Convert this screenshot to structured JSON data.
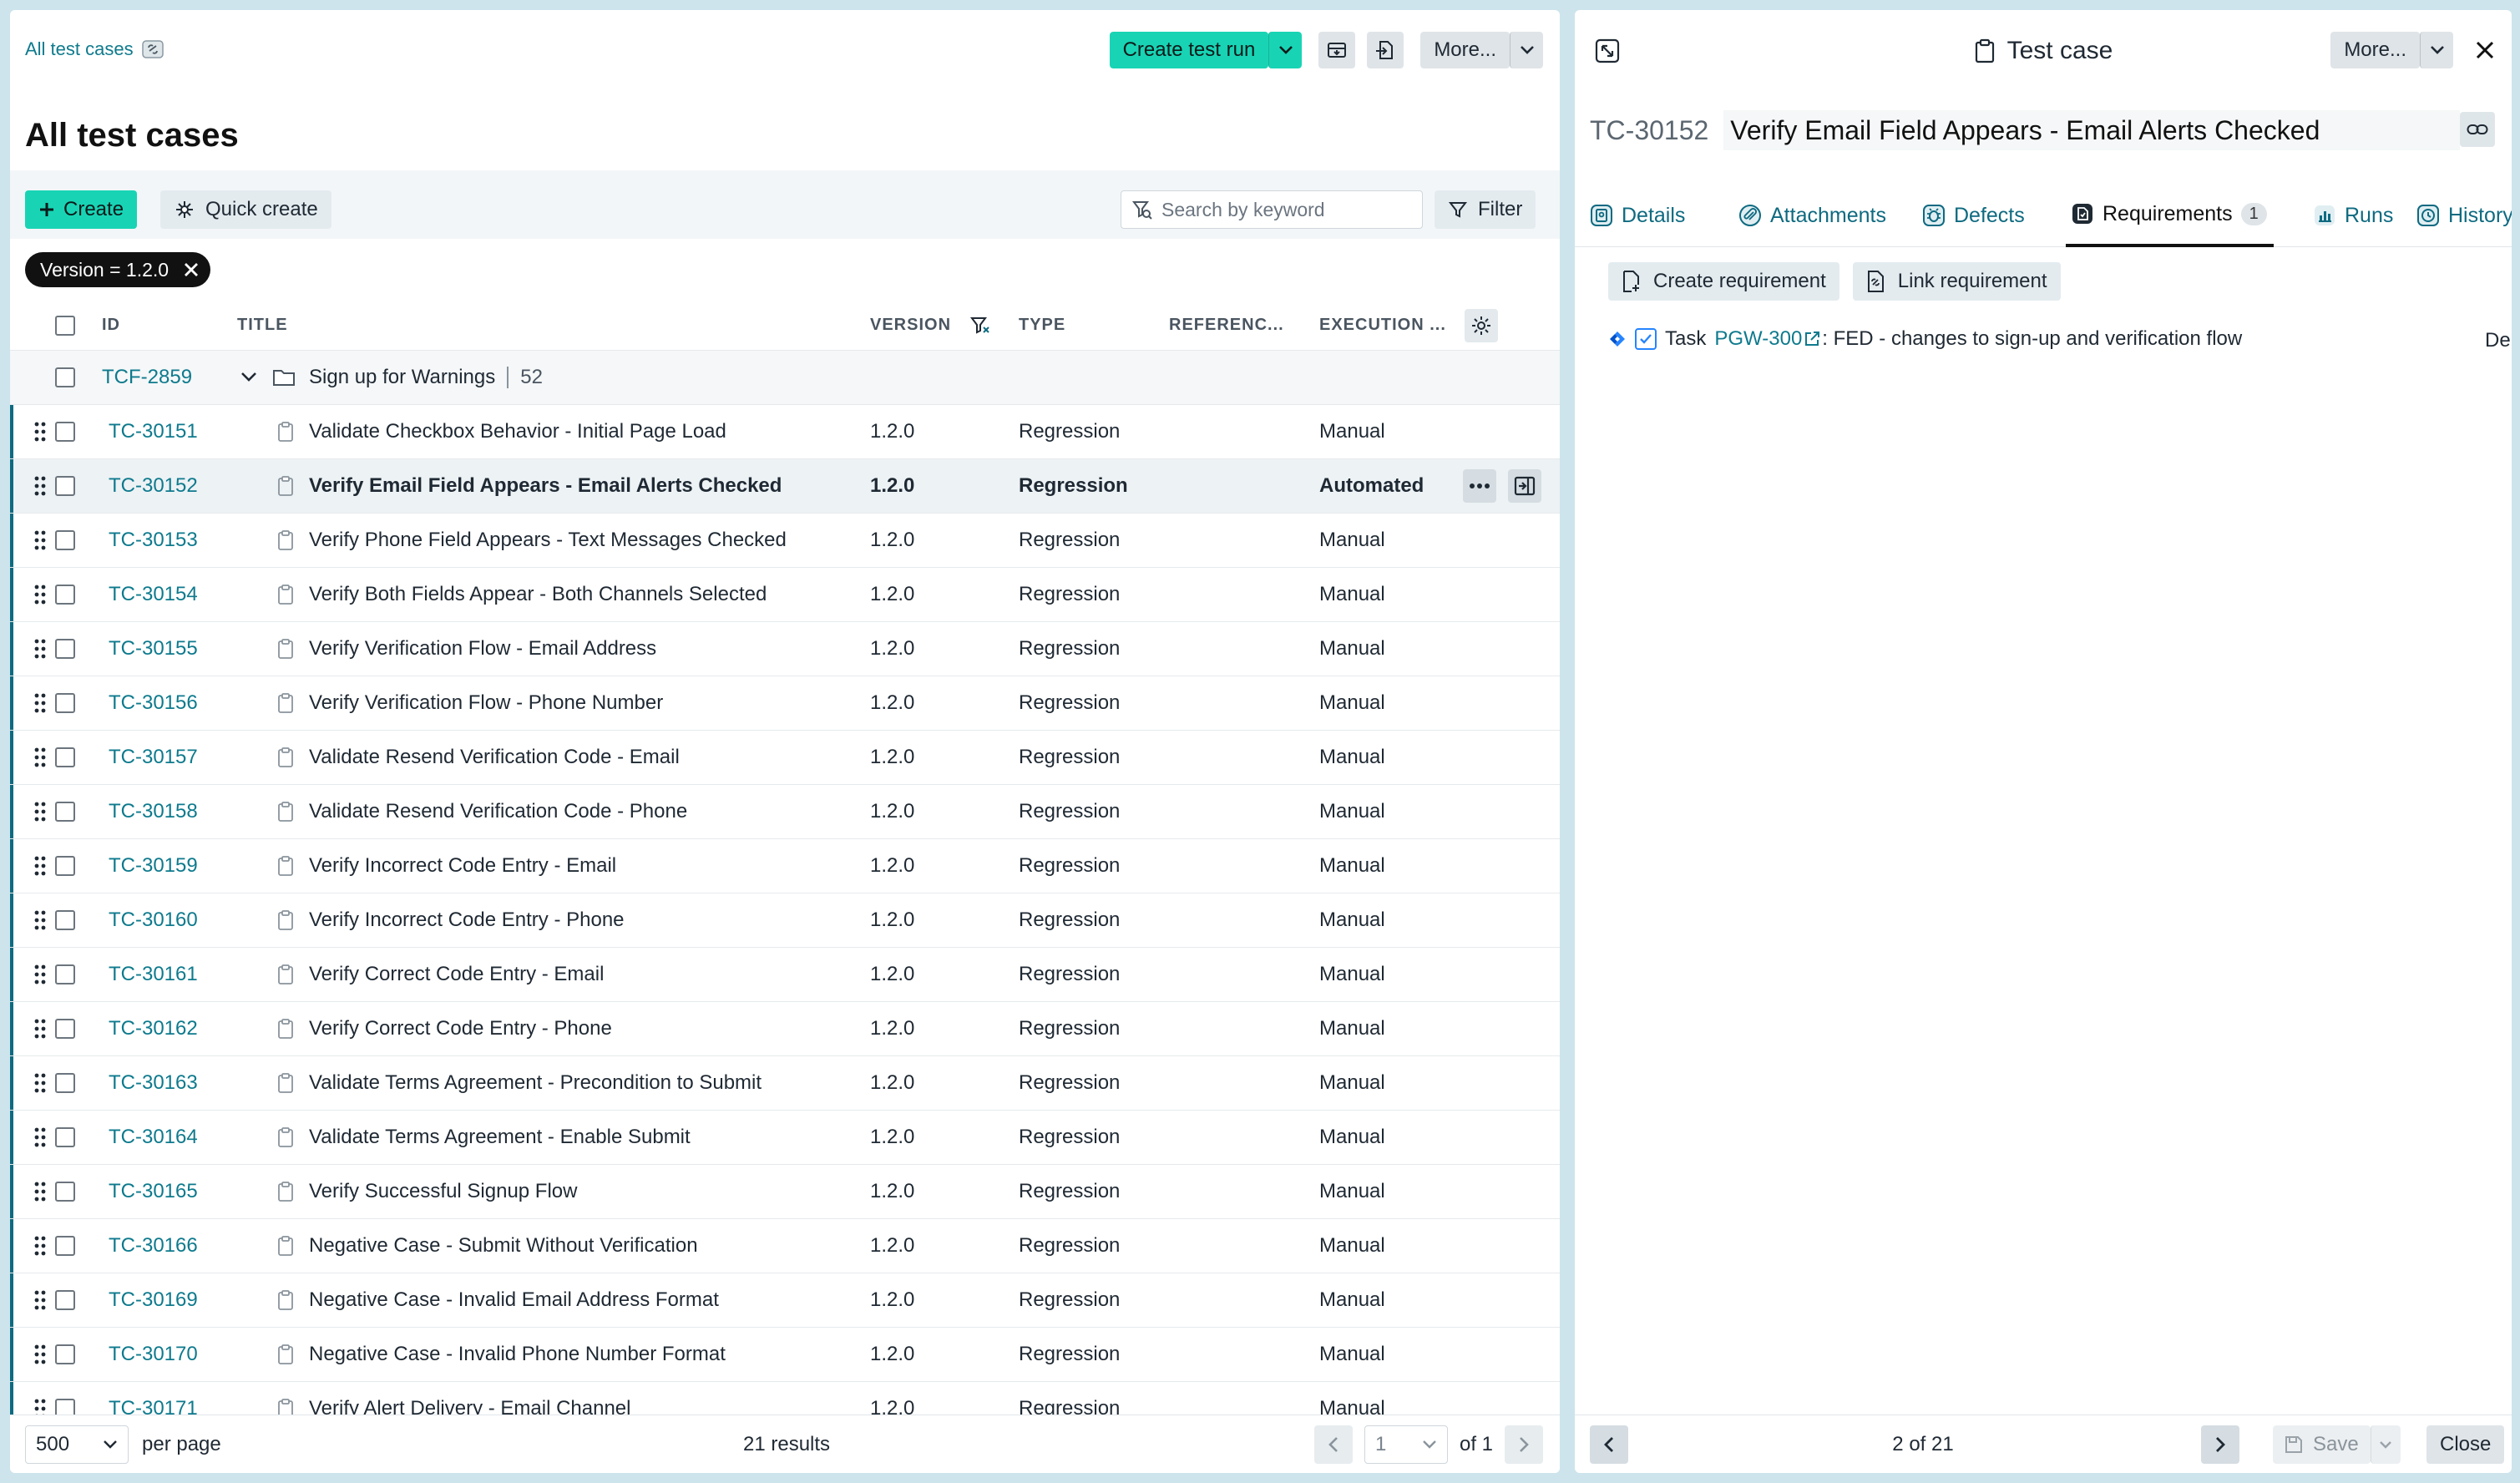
{
  "left": {
    "breadcrumb": "All test cases",
    "page_title": "All test cases",
    "header_actions": {
      "create_test_run": "Create test run",
      "more": "More..."
    },
    "toolbar": {
      "create": "Create",
      "quick_create": "Quick create",
      "search_placeholder": "Search by keyword",
      "filter": "Filter"
    },
    "filter_chip": "Version = 1.2.0",
    "columns": {
      "id": "ID",
      "title": "TITLE",
      "version": "VERSION",
      "type": "TYPE",
      "reference": "REFERENC...",
      "execution": "EXECUTION ..."
    },
    "group": {
      "id": "TCF-2859",
      "name": "Sign up for Warnings",
      "count": "52"
    },
    "rows": [
      {
        "id": "TC-30151",
        "title": "Validate Checkbox Behavior - Initial Page Load",
        "version": "1.2.0",
        "type": "Regression",
        "execution": "Manual"
      },
      {
        "id": "TC-30152",
        "title": "Verify Email Field Appears - Email Alerts Checked",
        "version": "1.2.0",
        "type": "Regression",
        "execution": "Automated"
      },
      {
        "id": "TC-30153",
        "title": "Verify Phone Field Appears - Text Messages Checked",
        "version": "1.2.0",
        "type": "Regression",
        "execution": "Manual"
      },
      {
        "id": "TC-30154",
        "title": "Verify Both Fields Appear - Both Channels Selected",
        "version": "1.2.0",
        "type": "Regression",
        "execution": "Manual"
      },
      {
        "id": "TC-30155",
        "title": "Verify Verification Flow - Email Address",
        "version": "1.2.0",
        "type": "Regression",
        "execution": "Manual"
      },
      {
        "id": "TC-30156",
        "title": "Verify Verification Flow - Phone Number",
        "version": "1.2.0",
        "type": "Regression",
        "execution": "Manual"
      },
      {
        "id": "TC-30157",
        "title": "Validate Resend Verification Code - Email",
        "version": "1.2.0",
        "type": "Regression",
        "execution": "Manual"
      },
      {
        "id": "TC-30158",
        "title": "Validate Resend Verification Code - Phone",
        "version": "1.2.0",
        "type": "Regression",
        "execution": "Manual"
      },
      {
        "id": "TC-30159",
        "title": "Verify Incorrect Code Entry - Email",
        "version": "1.2.0",
        "type": "Regression",
        "execution": "Manual"
      },
      {
        "id": "TC-30160",
        "title": "Verify Incorrect Code Entry - Phone",
        "version": "1.2.0",
        "type": "Regression",
        "execution": "Manual"
      },
      {
        "id": "TC-30161",
        "title": "Verify Correct Code Entry - Email",
        "version": "1.2.0",
        "type": "Regression",
        "execution": "Manual"
      },
      {
        "id": "TC-30162",
        "title": "Verify Correct Code Entry - Phone",
        "version": "1.2.0",
        "type": "Regression",
        "execution": "Manual"
      },
      {
        "id": "TC-30163",
        "title": "Validate Terms Agreement - Precondition to Submit",
        "version": "1.2.0",
        "type": "Regression",
        "execution": "Manual"
      },
      {
        "id": "TC-30164",
        "title": "Validate Terms Agreement - Enable Submit",
        "version": "1.2.0",
        "type": "Regression",
        "execution": "Manual"
      },
      {
        "id": "TC-30165",
        "title": "Verify Successful Signup Flow",
        "version": "1.2.0",
        "type": "Regression",
        "execution": "Manual"
      },
      {
        "id": "TC-30166",
        "title": "Negative Case - Submit Without Verification",
        "version": "1.2.0",
        "type": "Regression",
        "execution": "Manual"
      },
      {
        "id": "TC-30169",
        "title": "Negative Case - Invalid Email Address Format",
        "version": "1.2.0",
        "type": "Regression",
        "execution": "Manual"
      },
      {
        "id": "TC-30170",
        "title": "Negative Case - Invalid Phone Number Format",
        "version": "1.2.0",
        "type": "Regression",
        "execution": "Manual"
      },
      {
        "id": "TC-30171",
        "title": "Verify Alert Delivery - Email Channel",
        "version": "1.2.0",
        "type": "Regression",
        "execution": "Manual"
      }
    ],
    "selected_row": 1,
    "footer": {
      "per_page_value": "500",
      "per_page_label": "per page",
      "results": "21 results",
      "page_value": "1",
      "page_of": "of 1"
    }
  },
  "right": {
    "panel_title": "Test case",
    "more": "More...",
    "test_case_id": "TC-30152",
    "test_case_title": "Verify Email Field Appears - Email Alerts Checked",
    "tabs": [
      {
        "label": "Details",
        "icon": "details-icon"
      },
      {
        "label": "Attachments",
        "icon": "paperclip-icon"
      },
      {
        "label": "Defects",
        "icon": "bug-icon"
      },
      {
        "label": "Requirements",
        "icon": "document-icon",
        "badge": "1",
        "active": true
      },
      {
        "label": "Runs",
        "icon": "chart-icon"
      },
      {
        "label": "History",
        "icon": "history-icon"
      }
    ],
    "create_requirement": "Create requirement",
    "link_requirement": "Link requirement",
    "requirement": {
      "type": "Task",
      "key": "PGW-300",
      "summary": ": FED - changes to sign-up and verification flow",
      "status": "Delivered"
    },
    "footer": {
      "position": "2 of 21",
      "save": "Save",
      "close": "Close"
    }
  },
  "colors": {
    "primary": "#18d4b4",
    "link": "#0e7a8d",
    "selection_bar": "#0e6a80",
    "backdrop": "#cde4ec"
  }
}
